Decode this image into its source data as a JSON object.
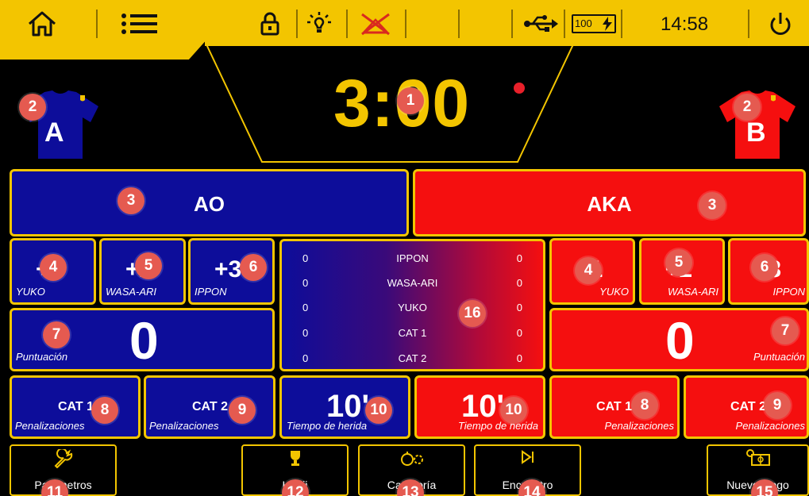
{
  "topbar": {
    "time": "14:58",
    "battery": "100"
  },
  "timer": {
    "value": "3:00"
  },
  "teams": {
    "left": {
      "shirt_letter": "A",
      "name": "AO",
      "color": "#0d0d9a"
    },
    "right": {
      "shirt_letter": "B",
      "name": "AKA",
      "color": "#f50f0f"
    }
  },
  "left": {
    "yuko_btn": "+1",
    "yuko_label": "YUKO",
    "wasaari_btn": "+2",
    "wasaari_label": "WASA-ARI",
    "ippon_btn": "+3",
    "ippon_label": "IPPON",
    "score": "0",
    "score_label": "Puntuación",
    "cat1": "CAT 1",
    "cat2": "CAT 2",
    "pen_label": "Penalizaciones",
    "injury": "10'",
    "injury_label": "Tiempo de herida"
  },
  "right": {
    "yuko_btn": "+1",
    "yuko_label": "YUKO",
    "wasaari_btn": "+2",
    "wasaari_label": "WASA-ARI",
    "ippon_btn": "+3",
    "ippon_label": "IPPON",
    "score": "0",
    "score_label": "Puntuación",
    "cat1": "CAT 1",
    "cat2": "CAT 2",
    "pen_label": "Penalizaciones",
    "injury": "10'",
    "injury_label": "Tiempo de herida"
  },
  "stats": [
    {
      "label": "IPPON",
      "left": "0",
      "right": "0"
    },
    {
      "label": "WASA-ARI",
      "left": "0",
      "right": "0"
    },
    {
      "label": "YUKO",
      "left": "0",
      "right": "0"
    },
    {
      "label": "CAT 1",
      "left": "0",
      "right": "0"
    },
    {
      "label": "CAT 2",
      "left": "0",
      "right": "0"
    }
  ],
  "bottom": {
    "params": "Parámetros",
    "hanji": "Hanji",
    "category": "Categoría",
    "nextfight": "Encuentro",
    "newgame": "Nuevo juego"
  },
  "badges": [
    "1",
    "2",
    "3",
    "4",
    "5",
    "6",
    "7",
    "8",
    "9",
    "10",
    "11",
    "12",
    "13",
    "14",
    "15",
    "16"
  ],
  "colors": {
    "accent": "#f3c500",
    "blue": "#0d0d9a",
    "red": "#f50f0f",
    "badge": "#e55a50"
  }
}
